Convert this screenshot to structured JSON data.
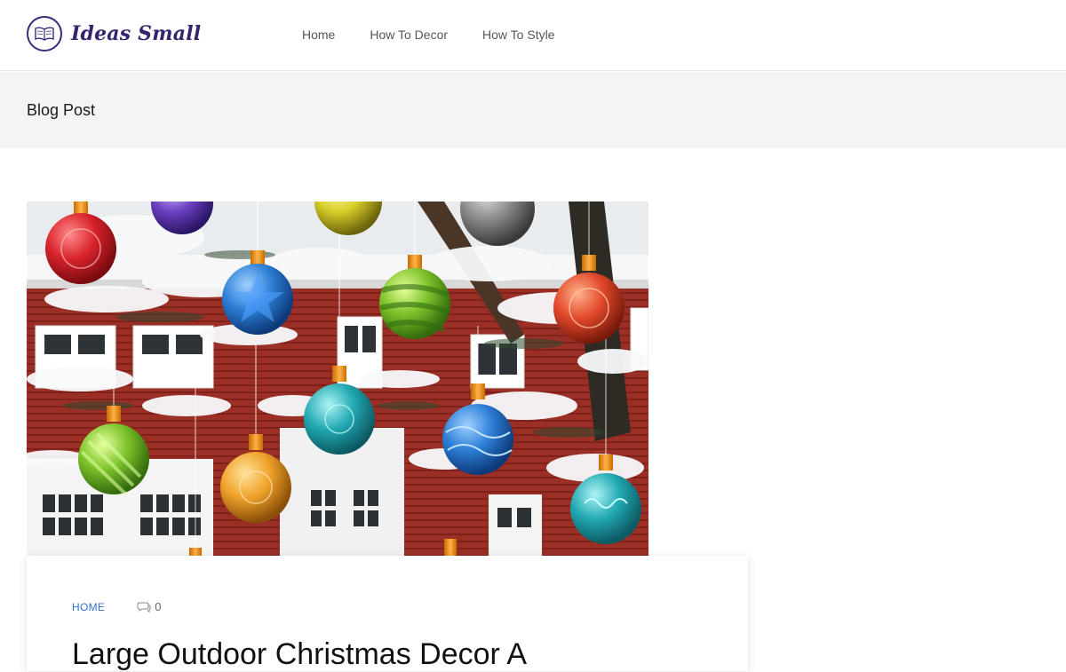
{
  "site": {
    "name": "Ideas Small"
  },
  "nav": {
    "items": [
      "Home",
      "How To Decor",
      "How To Style"
    ]
  },
  "page": {
    "title": "Blog Post"
  },
  "post": {
    "category": "HOME",
    "comment_count": "0",
    "title": "Large Outdoor Christmas Decor A"
  },
  "colors": {
    "brand": "#35236e",
    "link": "#2f6fcf",
    "title_bar": "#f4f4f4"
  },
  "icons": {
    "logo": "book-icon",
    "comments": "comment-bubble-icon"
  }
}
